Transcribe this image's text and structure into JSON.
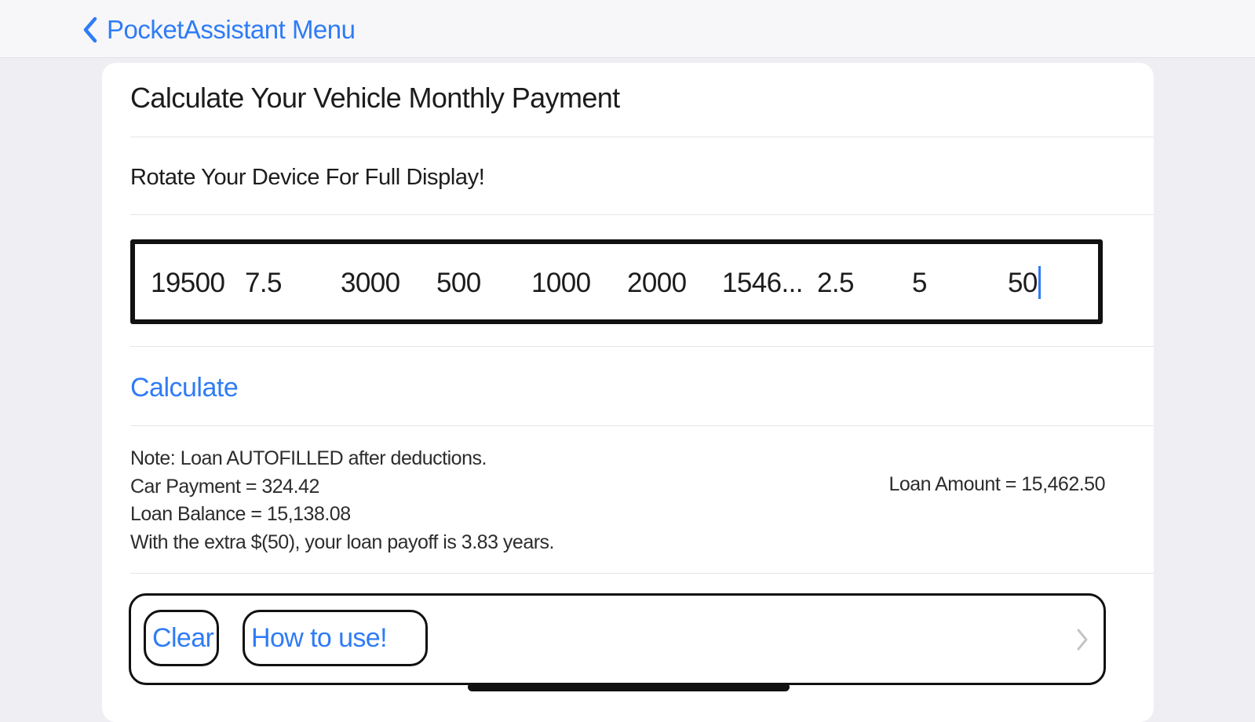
{
  "nav": {
    "back_label": "PocketAssistant Menu"
  },
  "card": {
    "title": "Calculate Your Vehicle Monthly Payment",
    "subtitle": "Rotate Your Device For Full Display!"
  },
  "inputs": {
    "fields": [
      "19500",
      "7.5",
      "3000",
      "500",
      "1000",
      "2000",
      "1546...",
      "2.5",
      "5",
      "50"
    ]
  },
  "actions": {
    "calculate_label": "Calculate"
  },
  "results": {
    "note": "Note: Loan AUTOFILLED after deductions.",
    "car_payment": "Car Payment = 324.42",
    "loan_balance": "Loan Balance = 15,138.08",
    "payoff": "With the extra $(50), your loan payoff is 3.83 years.",
    "loan_amount": "Loan Amount = 15,462.50"
  },
  "toolbar": {
    "clear_label": "Clear",
    "howto_label": "How to use!"
  },
  "colors": {
    "accent": "#2f7cf6",
    "background": "#eeeef3",
    "card": "#ffffff"
  },
  "icons": {
    "back": "chevron-left-icon",
    "disclosure": "chevron-right-icon"
  }
}
